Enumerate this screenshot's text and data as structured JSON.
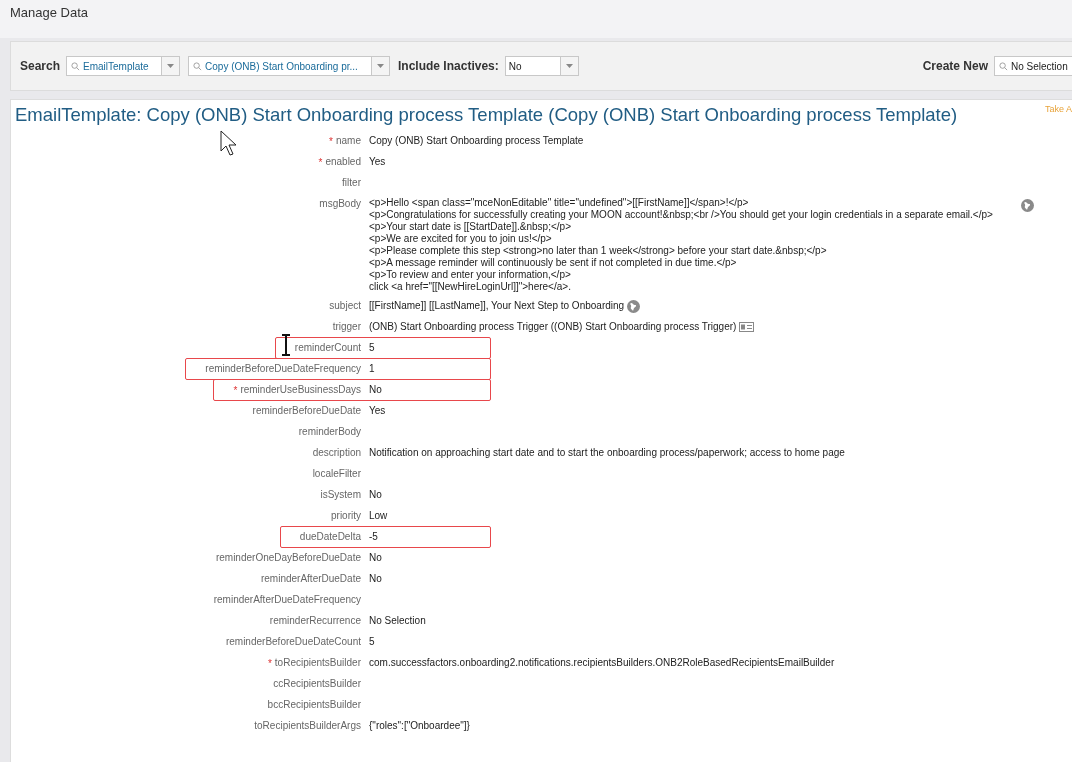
{
  "page_title": "Manage Data",
  "search_bar": {
    "search_label": "Search",
    "type_select": "EmailTemplate",
    "record_select": "Copy (ONB) Start Onboarding pr...",
    "inactives_label": "Include Inactives:",
    "inactives_select": "No",
    "create_label": "Create New",
    "create_select": "No Selection"
  },
  "record": {
    "title": "EmailTemplate: Copy (ONB) Start Onboarding process Template (Copy (ONB) Start Onboarding process Template)",
    "take_action": "Take A",
    "fields": [
      {
        "label": "name",
        "required_mark": "*",
        "highlighted": false,
        "value": "Copy (ONB) Start Onboarding process Template"
      },
      {
        "label": "enabled",
        "required_mark": "*",
        "highlighted": false,
        "value": "Yes"
      },
      {
        "label": "filter",
        "highlighted": false
      },
      {
        "label": "msgBody",
        "highlighted": false,
        "kind": "translatable-block",
        "lines": [
          "<p>Hello <span class=\"mceNonEditable\" title=\"undefined\">[[FirstName]]</span>!</p>",
          "<p>Congratulations for successfully creating your MOON account!&nbsp;<br />You should get your login credentials in a separate email.</p>",
          "<p>Your start date is [[StartDate]].&nbsp;</p>",
          "<p>We are excited for you to join us!</p>",
          "<p>Please complete this step <strong>no later than 1 week</strong> before your start date.&nbsp;</p>",
          "<p>A message reminder will continuously be sent if not completed in due time.</p>",
          "<p>To review and enter your information,</p>",
          "click <a href=\"[[NewHireLoginUrl]]\">here</a>."
        ]
      },
      {
        "label": "subject",
        "highlighted": false,
        "kind": "translatable",
        "value": "[[FirstName]] [[LastName]], Your Next Step to Onboarding"
      },
      {
        "label": "trigger",
        "highlighted": false,
        "kind": "reference",
        "value": "(ONB) Start Onboarding process Trigger ((ONB) Start Onboarding process Trigger)"
      },
      {
        "label": "reminderCount",
        "highlighted": true,
        "value": "5"
      },
      {
        "label": "reminderBeforeDueDateFrequency",
        "highlighted": true,
        "value": "1"
      },
      {
        "label": "reminderUseBusinessDays",
        "required_mark": "*",
        "highlighted": true,
        "value": "No"
      },
      {
        "label": "reminderBeforeDueDate",
        "highlighted": false,
        "value": "Yes"
      },
      {
        "label": "reminderBody",
        "highlighted": false
      },
      {
        "label": "description",
        "highlighted": false,
        "value": "Notification on approaching start date and to start the onboarding process/paperwork; access to home page"
      },
      {
        "label": "localeFilter",
        "highlighted": false
      },
      {
        "label": "isSystem",
        "highlighted": false,
        "value": "No"
      },
      {
        "label": "priority",
        "highlighted": false,
        "value": "Low"
      },
      {
        "label": "dueDateDelta",
        "highlighted": true,
        "value": "-5"
      },
      {
        "label": "reminderOneDayBeforeDueDate",
        "highlighted": false,
        "value": "No"
      },
      {
        "label": "reminderAfterDueDate",
        "highlighted": false,
        "value": "No"
      },
      {
        "label": "reminderAfterDueDateFrequency",
        "highlighted": false
      },
      {
        "label": "reminderRecurrence",
        "highlighted": false,
        "value": "No Selection"
      },
      {
        "label": "reminderBeforeDueDateCount",
        "highlighted": false,
        "value": "5"
      },
      {
        "label": "toRecipientsBuilder",
        "required_mark": "*",
        "highlighted": false,
        "value": "com.successfactors.onboarding2.notifications.recipientsBuilders.ONB2RoleBasedRecipientsEmailBuilder"
      },
      {
        "label": "ccRecipientsBuilder",
        "highlighted": false
      },
      {
        "label": "bccRecipientsBuilder",
        "highlighted": false
      },
      {
        "label": "toRecipientsBuilderArgs",
        "highlighted": false,
        "value": "{\"roles\":[\"Onboardee\"]}"
      }
    ]
  }
}
